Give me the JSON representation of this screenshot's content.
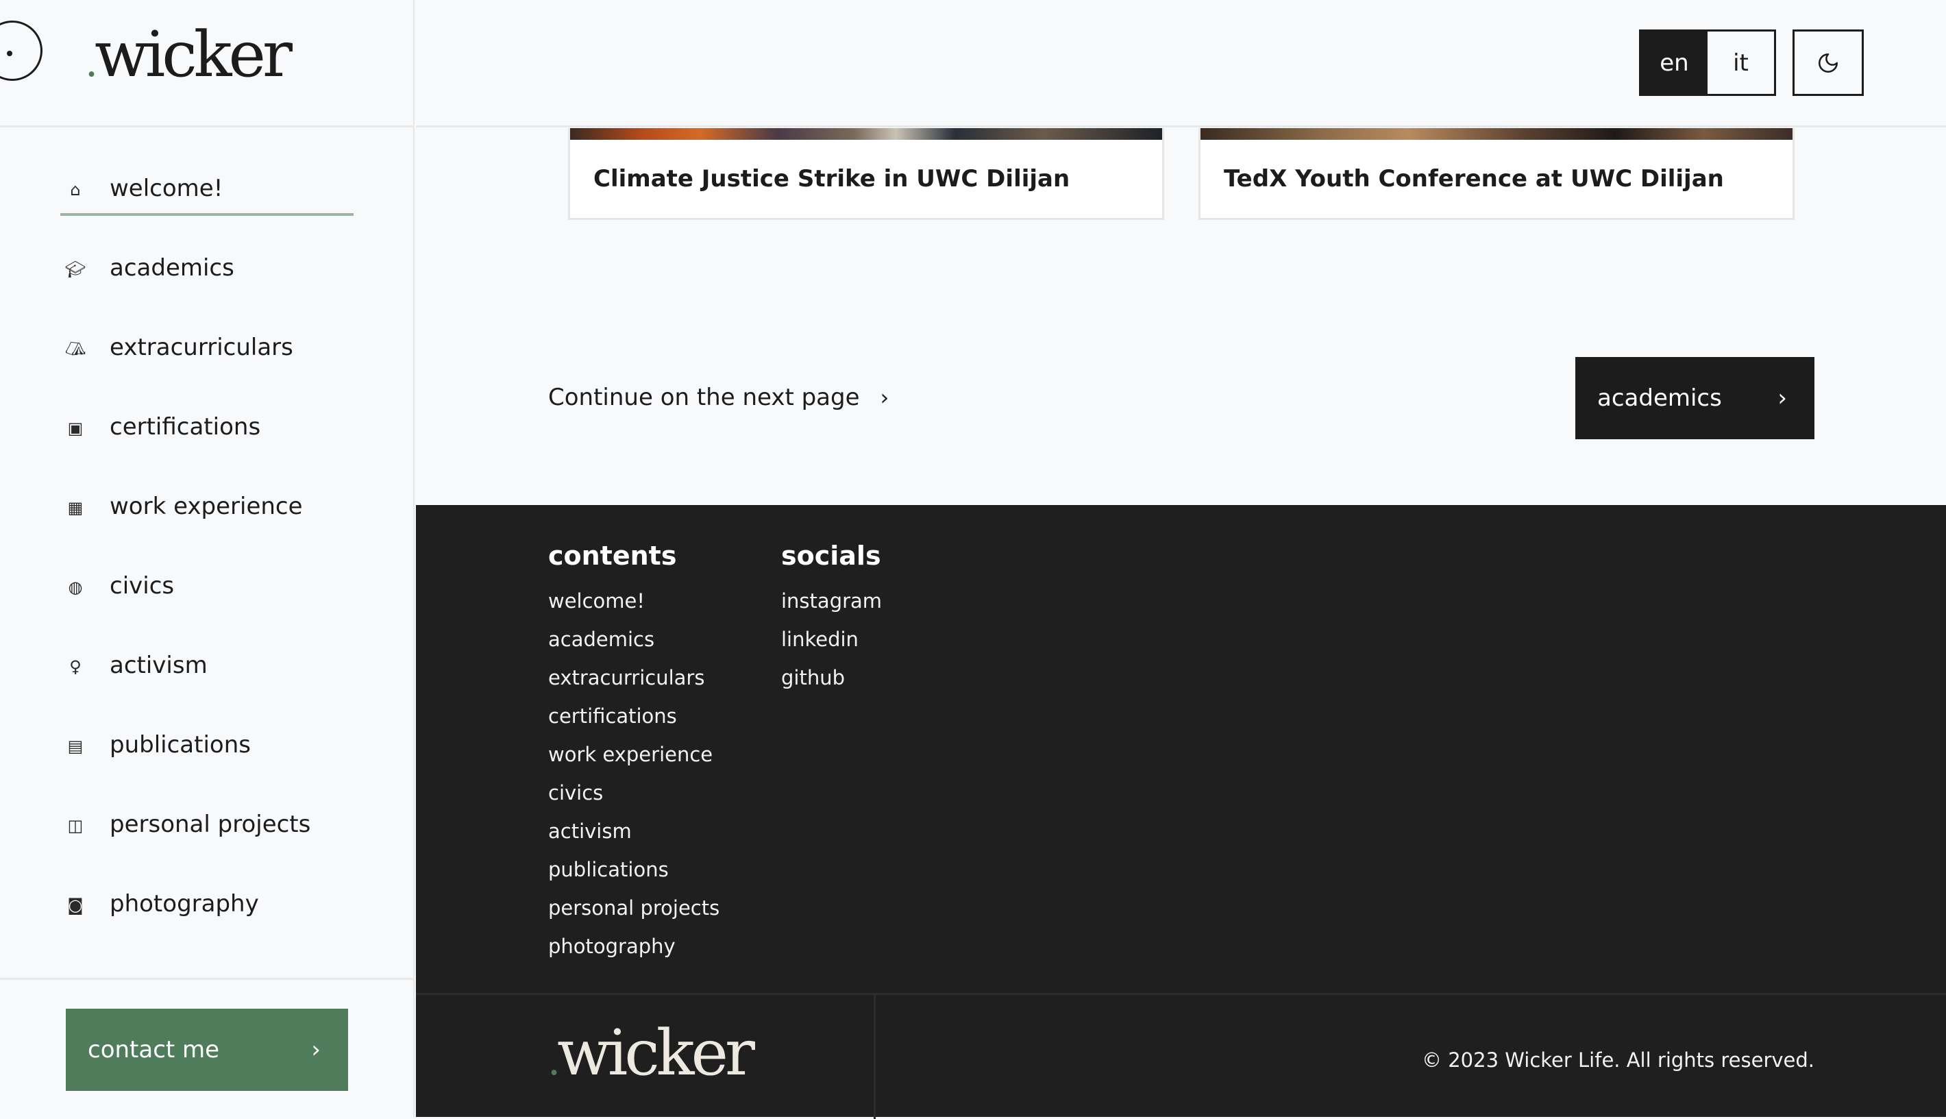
{
  "brand": {
    "dot": ".",
    "name": "wicker"
  },
  "sidebar": {
    "items": [
      {
        "label": "welcome!",
        "icon": "home-icon",
        "glyph": "⌂"
      },
      {
        "label": "academics",
        "icon": "graduation-cap-icon",
        "glyph": "🎓︎"
      },
      {
        "label": "extracurriculars",
        "icon": "tent-icon",
        "glyph": "⛺︎"
      },
      {
        "label": "certifications",
        "icon": "certificate-icon",
        "glyph": "▣"
      },
      {
        "label": "work experience",
        "icon": "buildings-icon",
        "glyph": "▦"
      },
      {
        "label": "civics",
        "icon": "globe-icon",
        "glyph": "◍"
      },
      {
        "label": "activism",
        "icon": "lamp-icon",
        "glyph": "♀"
      },
      {
        "label": "publications",
        "icon": "document-icon",
        "glyph": "▤"
      },
      {
        "label": "personal projects",
        "icon": "code-file-icon",
        "glyph": "◫"
      },
      {
        "label": "photography",
        "icon": "camera-icon",
        "glyph": "◙"
      }
    ],
    "contact_label": "contact me"
  },
  "topbar": {
    "lang_en": "en",
    "lang_it": "it"
  },
  "cards": [
    {
      "title": "Climate Justice Strike in UWC Dilijan"
    },
    {
      "title": "TedX Youth Conference at UWC Dilijan"
    }
  ],
  "continue": {
    "text": "Continue on the next page",
    "next_label": "academics"
  },
  "footer": {
    "contents_heading": "contents",
    "contents": [
      "welcome!",
      "academics",
      "extracurriculars",
      "certifications",
      "work experience",
      "civics",
      "activism",
      "publications",
      "personal projects",
      "photography"
    ],
    "socials_heading": "socials",
    "socials": [
      "instagram",
      "linkedin",
      "github"
    ],
    "copyright": "© 2023 Wicker Life. All rights reserved."
  },
  "colors": {
    "accent": "#4f7d5b",
    "dark": "#1c1c1c",
    "footer_bg": "#1f1f1f",
    "page_bg": "#f8f9fb"
  }
}
